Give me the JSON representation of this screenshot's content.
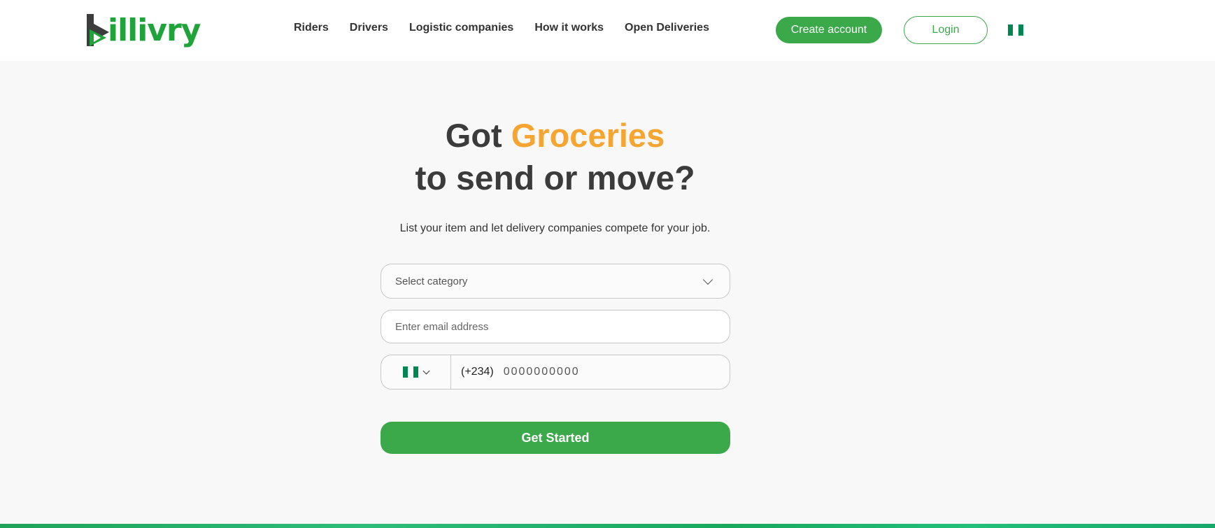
{
  "brand": {
    "name": "illivry",
    "green": "#1fa33a",
    "dark": "#3d3d3d"
  },
  "nav": [
    {
      "label": "Riders"
    },
    {
      "label": "Drivers"
    },
    {
      "label": "Logistic companies"
    },
    {
      "label": "How it works"
    },
    {
      "label": "Open Deliveries"
    }
  ],
  "header": {
    "create_label": "Create account",
    "login_label": "Login",
    "country_flag": "nigeria-flag"
  },
  "hero": {
    "title_prefix": "Got",
    "title_highlight": "Groceries",
    "title_line2": "to send or move?",
    "subtitle": "List your item and let delivery companies compete for your job.",
    "accent_color": "#f6a531"
  },
  "form": {
    "category_placeholder": "Select category",
    "email_placeholder": "Enter email address",
    "dial_code": "(+234)",
    "phone_placeholder": "0000000000",
    "submit_label": "Get Started",
    "button_color": "#3ba84a"
  }
}
